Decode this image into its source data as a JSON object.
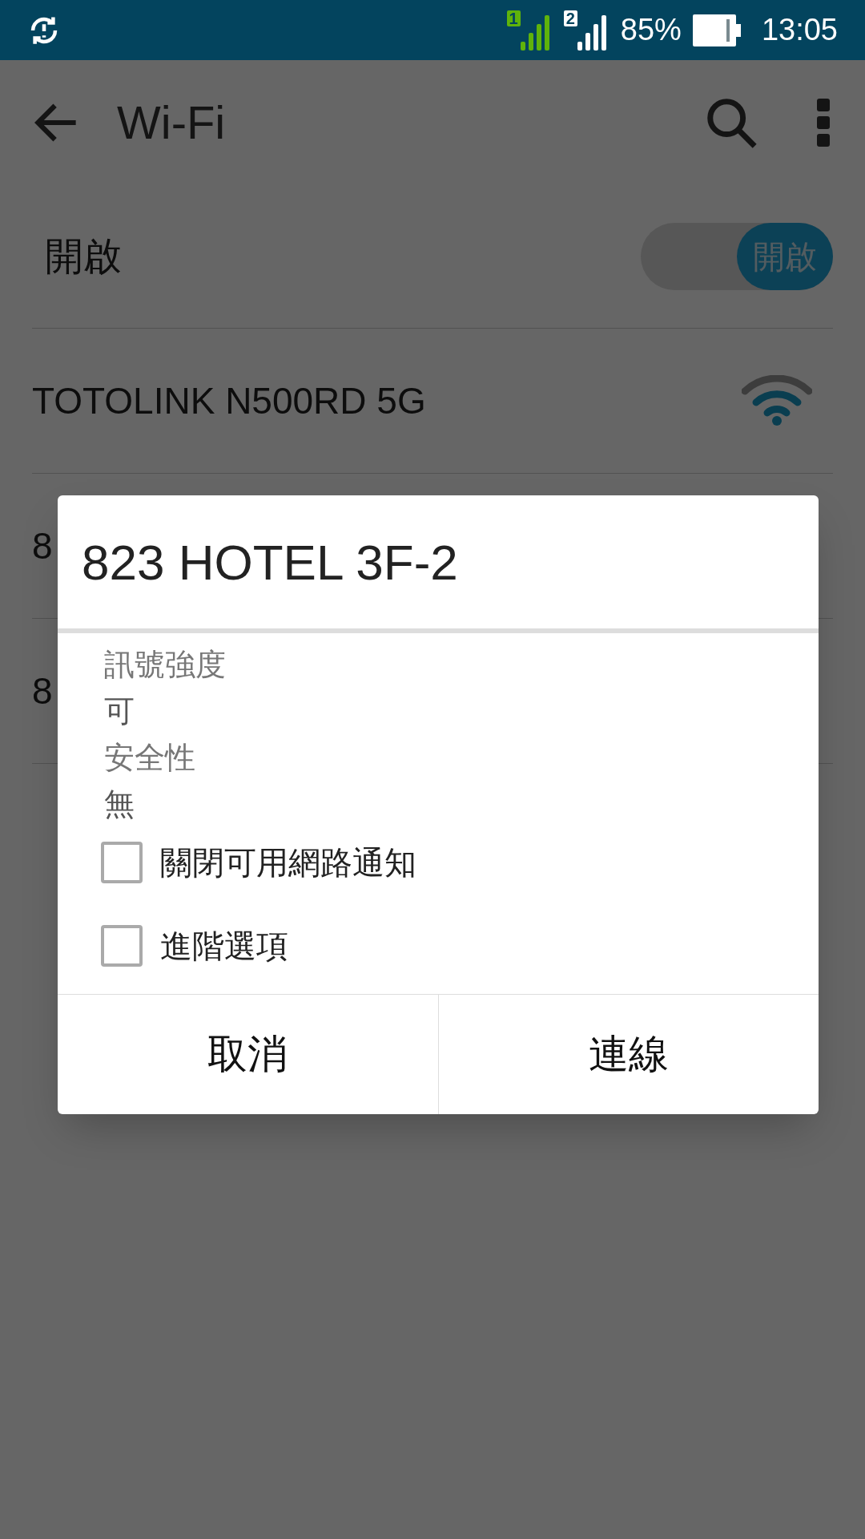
{
  "status_bar": {
    "sims": [
      "1",
      "2"
    ],
    "battery": "85%",
    "time": "13:05"
  },
  "toolbar": {
    "title": "Wi-Fi"
  },
  "wifi_switch": {
    "label": "開啟",
    "switch_text": "開啟",
    "on": true
  },
  "networks": [
    {
      "name": "TOTOLINK N500RD 5G",
      "signal_icon": true
    },
    {
      "name": "8",
      "signal_icon": false
    },
    {
      "name": "8",
      "signal_icon": false
    }
  ],
  "dialog": {
    "title": "823 HOTEL 3F-2",
    "details": [
      {
        "label": "訊號強度",
        "value": "可"
      },
      {
        "label": "安全性",
        "value": "無"
      }
    ],
    "checkboxes": [
      {
        "label": "關閉可用網路通知",
        "checked": false
      },
      {
        "label": "進階選項",
        "checked": false
      }
    ],
    "buttons": [
      "取消",
      "連線"
    ]
  }
}
